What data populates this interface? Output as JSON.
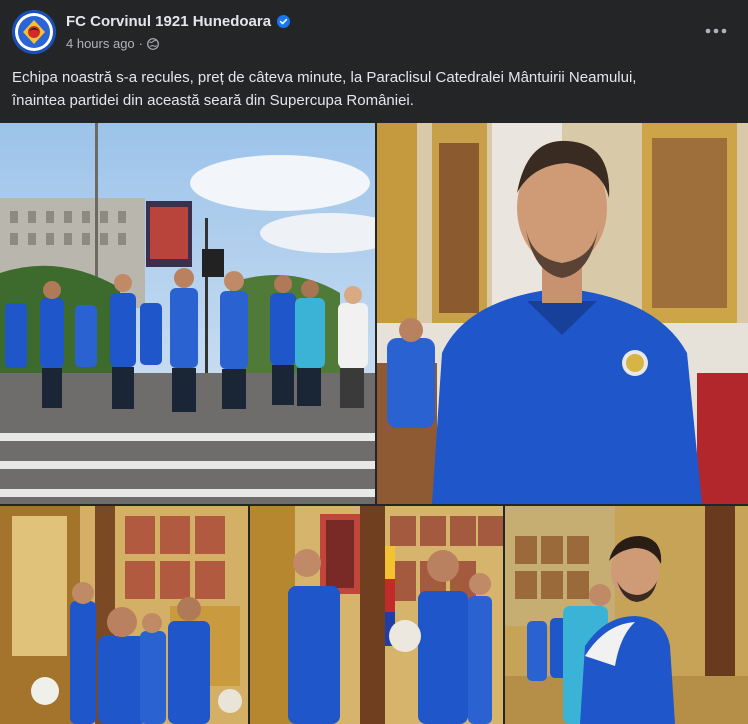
{
  "post": {
    "page_name": "FC Corvinul 1921 Hunedoara",
    "timestamp": "4 hours ago",
    "separator": "·",
    "caption_line1": "Echipa noastră s-a recules, preț de câteva minute, la Paraclisul Catedralei Mântuirii Neamului,",
    "caption_line2": "înaintea partidei din această seară din Supercupa României."
  },
  "icons": {
    "verified": "verified-badge-icon",
    "audience": "globe-icon",
    "more": "more-options-icon"
  },
  "colors": {
    "background": "#242526",
    "text_primary": "#e4e6eb",
    "text_secondary": "#b0b3b8",
    "verified": "#1877f2",
    "jersey_blue": "#1f56c9"
  }
}
